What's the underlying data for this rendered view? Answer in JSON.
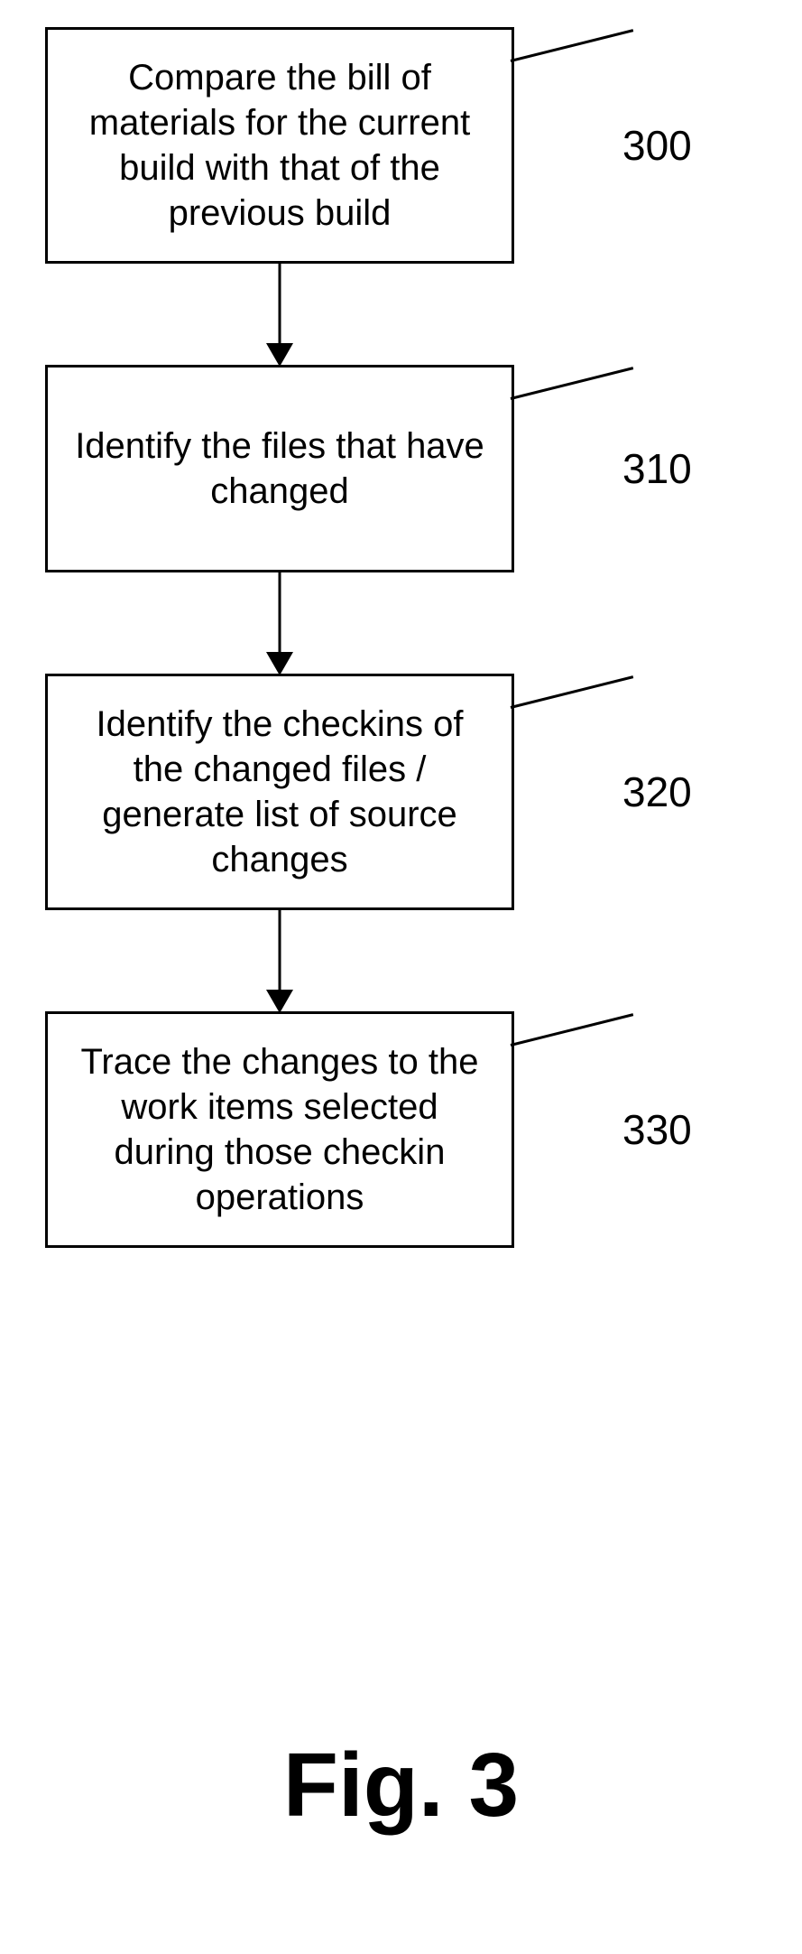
{
  "flowchart": {
    "steps": [
      {
        "text": "Compare the bill of materials for the current build with that of the previous build",
        "label": "300"
      },
      {
        "text": "Identify the files that have changed",
        "label": "310"
      },
      {
        "text": "Identify the checkins of the changed files / generate list of source changes",
        "label": "320"
      },
      {
        "text": "Trace the changes to the work items selected during those checkin operations",
        "label": "330"
      }
    ]
  },
  "caption": "Fig. 3"
}
